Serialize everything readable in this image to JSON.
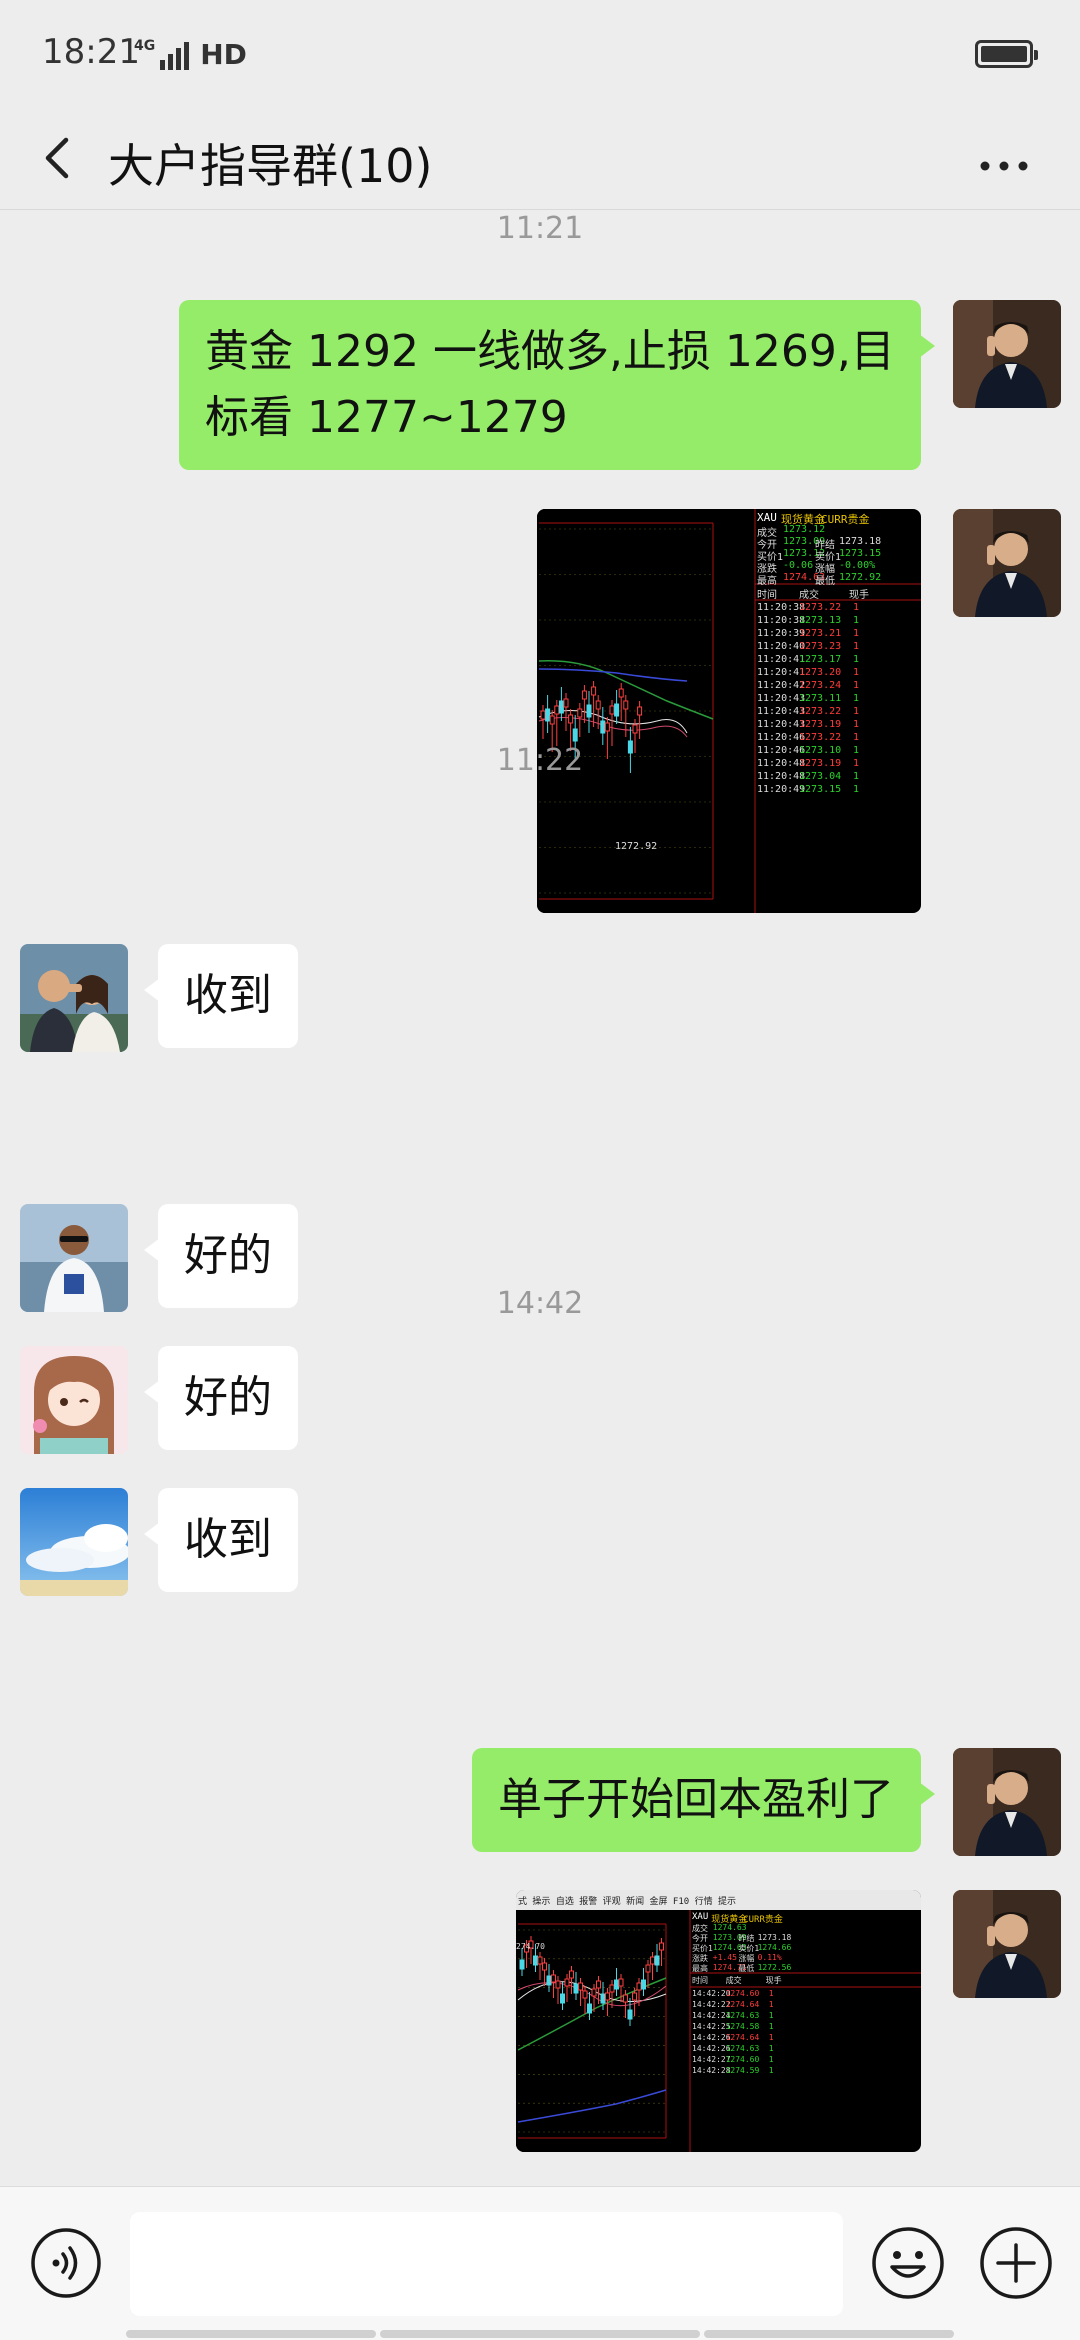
{
  "status": {
    "time": "18:21",
    "network": "4G",
    "hd": "HD"
  },
  "header": {
    "title": "大户指导群(10)",
    "back_icon": "chevron-left-icon",
    "more_icon": "more-dots-icon"
  },
  "messages": {
    "ts1": "11:21",
    "m1": "黄金 1292 一线做多,止损 1269,目标看 1277~1279",
    "m3": "收到",
    "ts2": "11:22",
    "m4": "好的",
    "m5": "好的",
    "m6": "收到",
    "ts3": "14:42",
    "m7": "单子开始回本盈利了"
  },
  "chart1": {
    "symbol": "XAU",
    "name": "现货黄金",
    "market": "CURR贵金",
    "last_label": "成交",
    "last": "1273.12",
    "open_label": "今开",
    "open": "1273.09",
    "prev_label": "昨结",
    "prev": "1273.18",
    "bid_label": "买价1",
    "bid": "1273.12",
    "ask_label": "卖价1",
    "ask": "1273.15",
    "chg_label": "涨跌",
    "chg": "-0.06",
    "pct_label": "涨幅",
    "pct": "-0.00%",
    "high_label": "最高",
    "high": "1274.63",
    "low_label": "最低",
    "low": "1272.92",
    "col_time": "时间",
    "col_price": "成交",
    "col_qty": "现手",
    "low_mark": "1272.92",
    "ticks": [
      {
        "time": "11:20:38",
        "price": "1273.22",
        "qty": "1",
        "c": "r"
      },
      {
        "time": "11:20:38",
        "price": "1273.13",
        "qty": "1",
        "c": "g"
      },
      {
        "time": "11:20:39",
        "price": "1273.21",
        "qty": "1",
        "c": "r"
      },
      {
        "time": "11:20:40",
        "price": "1273.23",
        "qty": "1",
        "c": "r"
      },
      {
        "time": "11:20:41",
        "price": "1273.17",
        "qty": "1",
        "c": "g"
      },
      {
        "time": "11:20:41",
        "price": "1273.20",
        "qty": "1",
        "c": "r"
      },
      {
        "time": "11:20:42",
        "price": "1273.24",
        "qty": "1",
        "c": "r"
      },
      {
        "time": "11:20:43",
        "price": "1273.11",
        "qty": "1",
        "c": "g"
      },
      {
        "time": "11:20:43",
        "price": "1273.22",
        "qty": "1",
        "c": "r"
      },
      {
        "time": "11:20:43",
        "price": "1273.19",
        "qty": "1",
        "c": "r"
      },
      {
        "time": "11:20:46",
        "price": "1273.22",
        "qty": "1",
        "c": "r"
      },
      {
        "time": "11:20:46",
        "price": "1273.10",
        "qty": "1",
        "c": "g"
      },
      {
        "time": "11:20:48",
        "price": "1273.19",
        "qty": "1",
        "c": "r"
      },
      {
        "time": "11:20:48",
        "price": "1273.04",
        "qty": "1",
        "c": "g"
      },
      {
        "time": "11:20:49",
        "price": "1273.15",
        "qty": "1",
        "c": "g"
      }
    ]
  },
  "chart2": {
    "symbol": "XAU",
    "name": "现货黄金",
    "market": "CURR贵金",
    "toolbar": "式 操示 自选 报警 评观 新闻 金屏 F10 行情 提示",
    "last_label": "成交",
    "last": "1274.63",
    "open_label": "今开",
    "open": "1273.09",
    "prev_label": "昨结",
    "prev": "1273.18",
    "bid_label": "买价1",
    "bid": "1274.63",
    "ask_label": "卖价1",
    "ask": "1274.66",
    "chg_label": "涨跌",
    "chg": "+1.45",
    "pct_label": "涨幅",
    "pct": "0.11%",
    "high_label": "最高",
    "high": "1274.71",
    "low_label": "最低",
    "low": "1272.56",
    "col_time": "时间",
    "col_price": "成交",
    "col_qty": "现手",
    "high_mark": "274.70",
    "ticks": [
      {
        "time": "14:42:20",
        "price": "1274.60",
        "qty": "1",
        "c": "r"
      },
      {
        "time": "14:42:22",
        "price": "1274.64",
        "qty": "1",
        "c": "r"
      },
      {
        "time": "14:42:24",
        "price": "1274.63",
        "qty": "1",
        "c": "g"
      },
      {
        "time": "14:42:25",
        "price": "1274.58",
        "qty": "1",
        "c": "g"
      },
      {
        "time": "14:42:26",
        "price": "1274.64",
        "qty": "1",
        "c": "r"
      },
      {
        "time": "14:42:26",
        "price": "1274.63",
        "qty": "1",
        "c": "g"
      },
      {
        "time": "14:42:27",
        "price": "1274.60",
        "qty": "1",
        "c": "g"
      },
      {
        "time": "14:42:28",
        "price": "1274.59",
        "qty": "1",
        "c": "g"
      }
    ]
  },
  "input": {
    "placeholder": ""
  },
  "colors": {
    "bg": "#ededed",
    "bubble_out": "#95ec69",
    "bubble_in": "#ffffff",
    "timestamp": "#999999"
  }
}
